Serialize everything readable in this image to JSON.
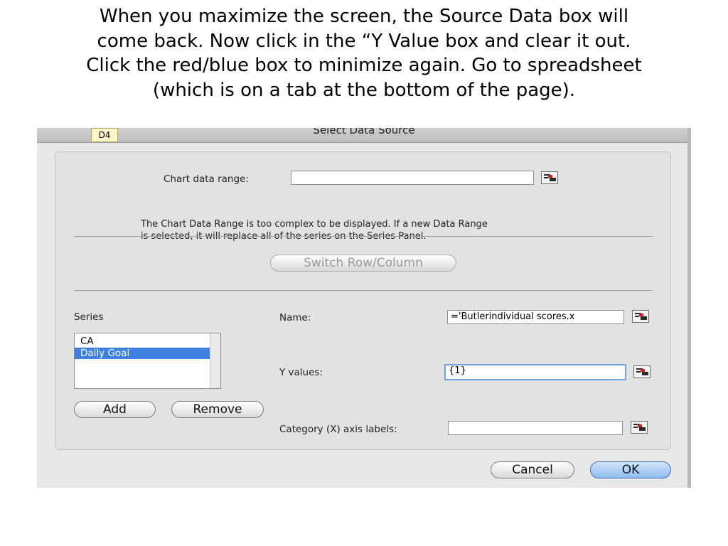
{
  "caption": {
    "lines": [
      "When you maximize the screen, the Source Data box will",
      "come back.  Now click in the “Y Value box and clear it out.",
      "Click the red/blue box to minimize again.  Go to spreadsheet",
      "(which is on a tab at the bottom of the page)."
    ]
  },
  "dialog": {
    "title": "Select Data Source",
    "cell_ref": "D4",
    "chart_data_range": {
      "label": "Chart data range:",
      "value": ""
    },
    "note_lines": [
      "The Chart Data Range is too complex to be displayed. If a new Data Range",
      "is selected, it will replace all of the series on the Series Panel."
    ],
    "switch_button": "Switch Row/Column",
    "series": {
      "label": "Series",
      "items": [
        "CA",
        "Daily Goal"
      ],
      "selected": "Daily Goal"
    },
    "add_button": "Add",
    "remove_button": "Remove",
    "name": {
      "label": "Name:",
      "value": "='Butlerindividual scores.x"
    },
    "y_values": {
      "label": "Y values:",
      "value": "{1}"
    },
    "category_axis": {
      "label": "Category (X) axis labels:",
      "value": ""
    },
    "cancel_button": "Cancel",
    "ok_button": "OK",
    "icons": {
      "range_picker": "range-picker-icon"
    },
    "colors": {
      "selection": "#3d80df",
      "focus_ring": "#6fa0db",
      "ok_button": "#8fbdf0"
    }
  }
}
